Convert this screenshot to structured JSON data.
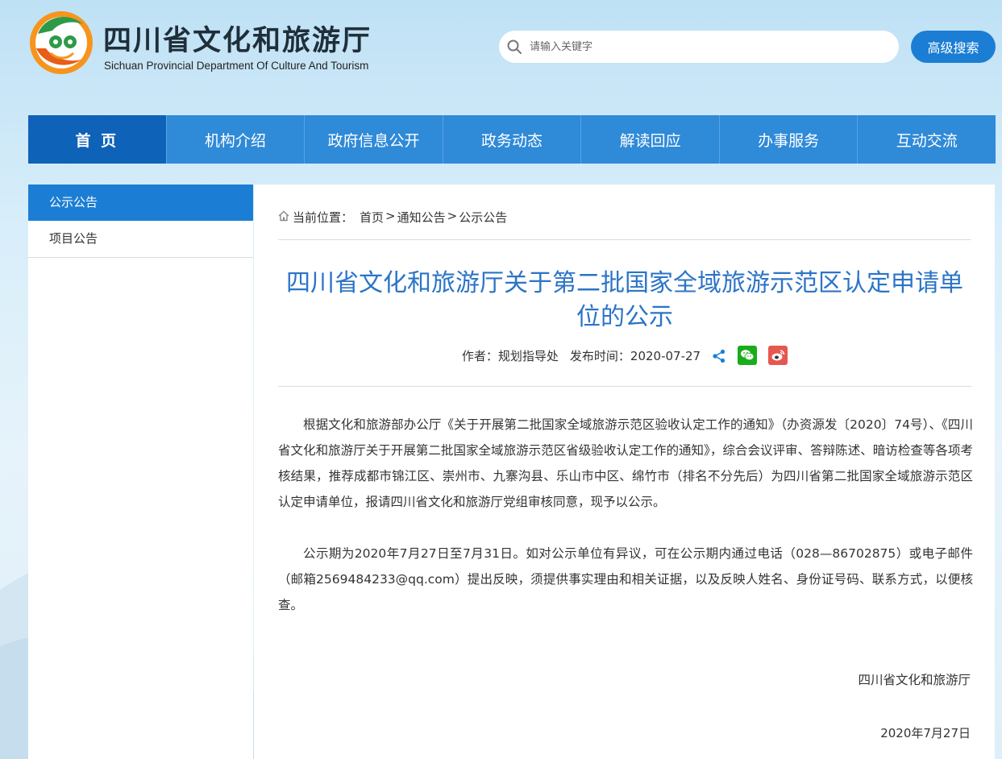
{
  "header": {
    "title_cn": "四川省文化和旅游厅",
    "title_en": "Sichuan Provincial Department Of Culture And Tourism",
    "search_placeholder": "请输入关键字",
    "advanced_search_label": "高级搜索"
  },
  "nav": {
    "items": [
      "首 页",
      "机构介绍",
      "政府信息公开",
      "政务动态",
      "解读回应",
      "办事服务",
      "互动交流"
    ],
    "active_index": 0
  },
  "sidebar": {
    "items": [
      "公示公告",
      "项目公告"
    ],
    "active_index": 0
  },
  "breadcrumb": {
    "prefix": "当前位置：",
    "items": [
      "首页",
      "通知公告",
      "公示公告"
    ],
    "separator": ">"
  },
  "article": {
    "title": "四川省文化和旅游厅关于第二批国家全域旅游示范区认定申请单位的公示",
    "author_label": "作者：规划指导处",
    "publish_label": "发布时间：2020-07-27",
    "paragraphs": [
      "根据文化和旅游部办公厅《关于开展第二批国家全域旅游示范区验收认定工作的通知》（办资源发〔2020〕74号）、《四川省文化和旅游厅关于开展第二批国家全域旅游示范区省级验收认定工作的通知》，综合会议评审、答辩陈述、暗访检查等各项考核结果，推荐成都市锦江区、崇州市、九寨沟县、乐山市中区、绵竹市（排名不分先后）为四川省第二批国家全域旅游示范区认定申请单位，报请四川省文化和旅游厅党组审核同意，现予以公示。",
      "公示期为2020年7月27日至7月31日。如对公示单位有异议，可在公示期内通过电话（028—86702875）或电子邮件（邮箱2569484233@qq.com）提出反映，须提供事实理由和相关证据，以及反映人姓名、身份证号码、联系方式，以便核查。"
    ],
    "signature": "四川省文化和旅游厅",
    "date": "2020年7月27日"
  },
  "icons": [
    "search-icon",
    "home-icon",
    "share-icon",
    "wechat-icon",
    "weibo-icon",
    "logo-emblem"
  ],
  "colors": {
    "nav_bg": "#2f8ad8",
    "nav_active": "#0e62b8",
    "accent": "#1b7ed4",
    "title": "#2b74c7",
    "wechat": "#1aad19",
    "weibo": "#e6574f"
  }
}
